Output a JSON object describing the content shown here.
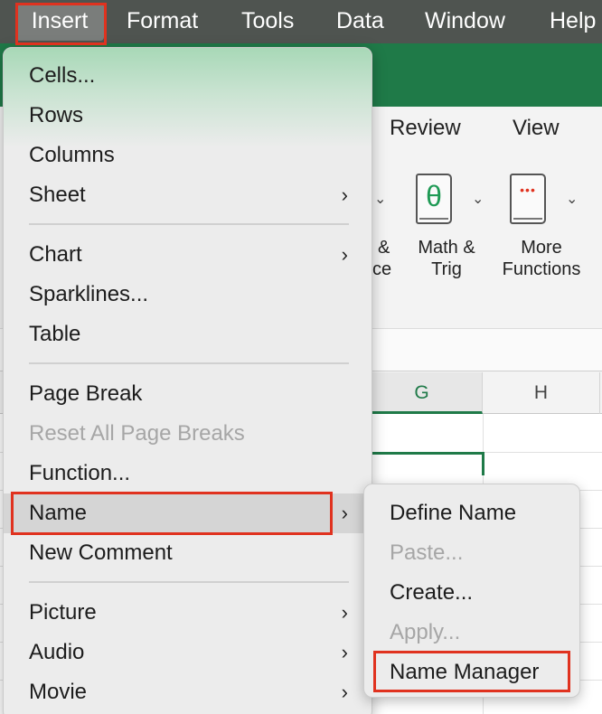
{
  "menubar": {
    "items": [
      "Insert",
      "Format",
      "Tools",
      "Data",
      "Window",
      "Help"
    ]
  },
  "ribbon": {
    "tabs": [
      "Review",
      "View"
    ],
    "partial_label_1": "&",
    "partial_label_2": "ce",
    "math_trig_label_1": "Math &",
    "math_trig_label_2": "Trig",
    "more_functions_label_1": "More",
    "more_functions_label_2": "Functions",
    "math_glyph": "θ",
    "more_glyph": "•••"
  },
  "sheet": {
    "columns": [
      "G",
      "H"
    ]
  },
  "insert_menu": {
    "items": [
      {
        "label": "Cells...",
        "submenu": false,
        "enabled": true
      },
      {
        "label": "Rows",
        "submenu": false,
        "enabled": true
      },
      {
        "label": "Columns",
        "submenu": false,
        "enabled": true
      },
      {
        "label": "Sheet",
        "submenu": true,
        "enabled": true
      },
      {
        "label": "Chart",
        "submenu": true,
        "enabled": true
      },
      {
        "label": "Sparklines...",
        "submenu": false,
        "enabled": true
      },
      {
        "label": "Table",
        "submenu": false,
        "enabled": true
      },
      {
        "label": "Page Break",
        "submenu": false,
        "enabled": true
      },
      {
        "label": "Reset All Page Breaks",
        "submenu": false,
        "enabled": false
      },
      {
        "label": "Function...",
        "submenu": false,
        "enabled": true
      },
      {
        "label": "Name",
        "submenu": true,
        "enabled": true
      },
      {
        "label": "New Comment",
        "submenu": false,
        "enabled": true
      },
      {
        "label": "Picture",
        "submenu": true,
        "enabled": true
      },
      {
        "label": "Audio",
        "submenu": true,
        "enabled": true
      },
      {
        "label": "Movie",
        "submenu": true,
        "enabled": true
      }
    ]
  },
  "name_submenu": {
    "items": [
      {
        "label": "Define Name",
        "enabled": true
      },
      {
        "label": "Paste...",
        "enabled": false
      },
      {
        "label": "Create...",
        "enabled": true
      },
      {
        "label": "Apply...",
        "enabled": false
      },
      {
        "label": "Name Manager",
        "enabled": true
      }
    ]
  },
  "colors": {
    "excel_green": "#1f7a48",
    "highlight_red": "#e0321f",
    "menubar_bg": "#4f5450"
  }
}
